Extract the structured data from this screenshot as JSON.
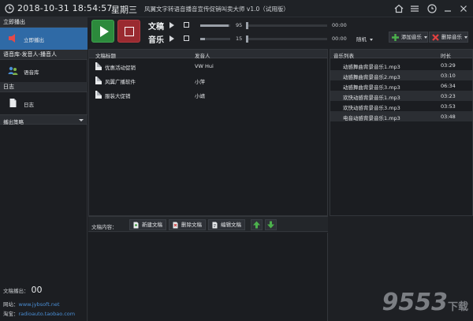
{
  "titlebar": {
    "datetime": "2018-10-31 18:54:57",
    "weekday": "星期三",
    "app_title": "风翼文字转语音播音宣传促销叫卖大师 v1.0（试用版）",
    "window_buttons": [
      "home-icon",
      "settings-icon",
      "clock-icon",
      "minimize-icon",
      "close-icon"
    ]
  },
  "sidebar": {
    "section_broadcast": "立即播出",
    "item_broadcast": "立即播出",
    "section_library": "语音库-发音人-播音人",
    "item_library": "语音库",
    "section_log": "日志",
    "item_log": "日志",
    "strategy_select": "播出策略",
    "counter_label": "文稿播出：",
    "counter_value": "00",
    "website_label": "网站：",
    "website_value": "www.jybsoft.net",
    "taobao_label": "淘宝：",
    "taobao_value": "radioauto.taobao.com"
  },
  "player": {
    "script_label": "文稿",
    "music_label": "音乐",
    "script_volume": "95",
    "music_volume": "15",
    "script_time": "00:00",
    "music_time": "00:00",
    "play_mode": "随机",
    "add_music_btn": "添加音乐",
    "delete_music_btn": "删除音乐",
    "accent_play": "#2c8a3c",
    "accent_stop": "#9a2a30",
    "accent_active": "#2f6aa6"
  },
  "scripts": {
    "col_title": "文稿标题",
    "col_speaker": "发音人",
    "rows": [
      {
        "title": "优惠活动促销",
        "speaker": "VW Hui"
      },
      {
        "title": "风翼广播软件",
        "speaker": "小萍"
      },
      {
        "title": "服装大促销",
        "speaker": "小靖"
      }
    ]
  },
  "music": {
    "col_list": "音乐列表",
    "col_duration": "时长",
    "rows": [
      {
        "name": "动感舞曲背景音乐1.mp3",
        "duration": "03:29"
      },
      {
        "name": "动感舞曲背景音乐2.mp3",
        "duration": "03:10"
      },
      {
        "name": "动感舞曲背景音乐3.mp3",
        "duration": "06:34"
      },
      {
        "name": "欢快动感背景音乐1.mp3",
        "duration": "03:23"
      },
      {
        "name": "欢快动感背景音乐3.mp3",
        "duration": "03:53"
      },
      {
        "name": "电音动感背景音乐1.mp3",
        "duration": "03:48"
      }
    ]
  },
  "toolbar": {
    "content_label": "文稿内容：",
    "new_btn": "新建文稿",
    "delete_btn": "删除文稿",
    "edit_btn": "编辑文稿"
  },
  "watermark": {
    "text": "9553",
    "suffix": "下载"
  }
}
